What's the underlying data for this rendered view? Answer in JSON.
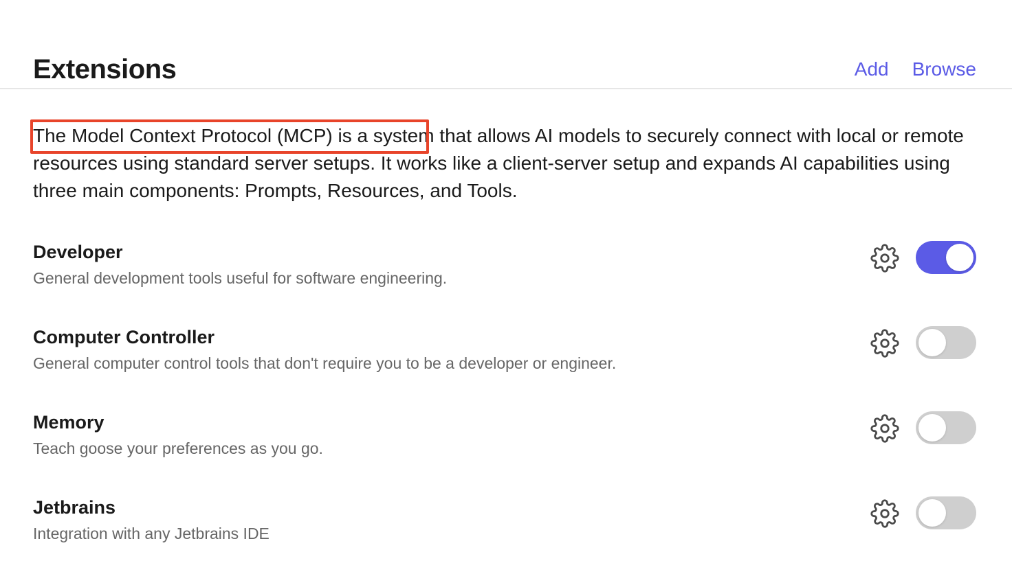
{
  "header": {
    "title": "Extensions",
    "add_label": "Add",
    "browse_label": "Browse"
  },
  "intro": {
    "highlighted": "The Model Context Protocol (MCP) is a system",
    "rest": " that allows AI models to securely connect with local or remote resources using standard server setups. It works like a client-server setup and expands AI capabilities using three main components: Prompts, Resources, and Tools."
  },
  "extensions": [
    {
      "name": "Developer",
      "description": "General development tools useful for software engineering.",
      "enabled": true
    },
    {
      "name": "Computer Controller",
      "description": "General computer control tools that don't require you to be a developer or engineer.",
      "enabled": false
    },
    {
      "name": "Memory",
      "description": "Teach goose your preferences as you go.",
      "enabled": false
    },
    {
      "name": "Jetbrains",
      "description": "Integration with any Jetbrains IDE",
      "enabled": false
    }
  ],
  "colors": {
    "accent": "#5b5be6",
    "highlight_border": "#e8442a",
    "toggle_off": "#cfcfcf"
  },
  "icons": {
    "settings": "gear-icon"
  }
}
